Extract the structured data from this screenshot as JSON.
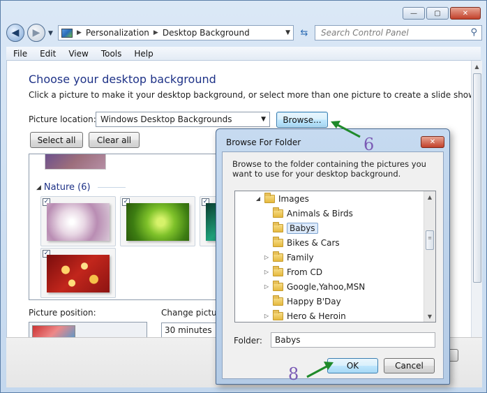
{
  "window": {
    "caption_buttons": {
      "minimize": "—",
      "maximize": "▢",
      "close": "✕"
    },
    "address": {
      "segments": [
        "Personalization",
        "Desktop Background"
      ],
      "search_placeholder": "Search Control Panel"
    },
    "menu": [
      "File",
      "Edit",
      "View",
      "Tools",
      "Help"
    ],
    "content": {
      "heading": "Choose your desktop background",
      "description": "Click a picture to make it your desktop background, or select more than one picture to create a slide show.",
      "picture_location_label": "Picture location:",
      "picture_location_value": "Windows Desktop Backgrounds",
      "browse_label": "Browse...",
      "select_all_label": "Select all",
      "clear_all_label": "Clear all",
      "group_name": "Nature (6)",
      "picture_position_label": "Picture position:",
      "change_picture_label": "Change picture",
      "change_interval_value": "30 minutes"
    }
  },
  "dialog": {
    "title": "Browse For Folder",
    "description": "Browse to the folder containing the pictures you want to use for your desktop background.",
    "tree": [
      {
        "label": "Images",
        "expand": "◢",
        "selected": false
      },
      {
        "label": "Animals & Birds",
        "expand": "",
        "selected": false
      },
      {
        "label": "Babys",
        "expand": "",
        "selected": true
      },
      {
        "label": "Bikes & Cars",
        "expand": "",
        "selected": false
      },
      {
        "label": "Family",
        "expand": "▷",
        "selected": false
      },
      {
        "label": "From CD",
        "expand": "▷",
        "selected": false
      },
      {
        "label": "Google,Yahoo,MSN",
        "expand": "▷",
        "selected": false
      },
      {
        "label": "Happy B'Day",
        "expand": "",
        "selected": false
      },
      {
        "label": "Hero & Heroin",
        "expand": "▷",
        "selected": false
      }
    ],
    "folder_label": "Folder:",
    "folder_value": "Babys",
    "ok_label": "OK",
    "cancel_label": "Cancel"
  },
  "annotations": {
    "step_browse": "6",
    "step_ok": "8"
  },
  "colors": {
    "heading": "#1e3287",
    "annotation": "#7b5bb5",
    "arrow": "#1f8a2a"
  }
}
